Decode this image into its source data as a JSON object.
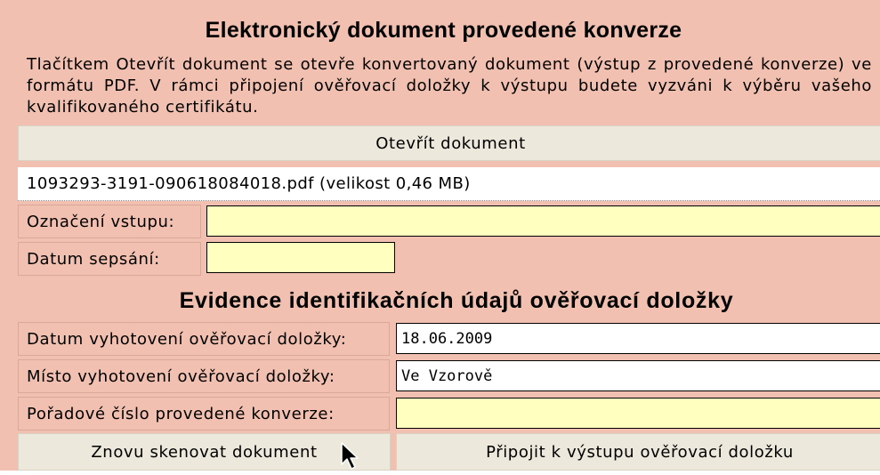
{
  "section1": {
    "title": "Elektronický dokument provedené konverze",
    "description": "Tlačítkem Otevřít dokument se otevře konvertovaný dokument (výstup z provedené konverze) ve formátu PDF. V rámci připojení ověřovací doložky k výstupu budete vyzváni k výběru vašeho kvalifikovaného certifikátu.",
    "open_button": "Otevřít dokument",
    "file_info": "1093293-3191-090618084018.pdf (velikost 0,46 MB)",
    "fields": {
      "input_label": "Označení vstupu:",
      "input_value": "",
      "date_written_label": "Datum sepsání:",
      "date_written_value": ""
    }
  },
  "section2": {
    "title": "Evidence identifikačních údajů ověřovací doložky",
    "fields": {
      "date_label": "Datum vyhotovení ověřovací doložky:",
      "date_value": "18.06.2009",
      "place_label": "Místo vyhotovení ověřovací doložky:",
      "place_value": "Ve Vzorově",
      "number_label": "Pořadové číslo provedené konverze:",
      "number_value": ""
    }
  },
  "buttons": {
    "rescan": "Znovu skenovat dokument",
    "attach": "Připojit k výstupu ověřovací doložku"
  },
  "colors": {
    "background": "#f2c0b0",
    "button": "#ece8dc",
    "input_yellow": "#ffffc0",
    "input_white": "#ffffff"
  },
  "icons": {
    "cursor": "mouse-pointer-icon"
  }
}
